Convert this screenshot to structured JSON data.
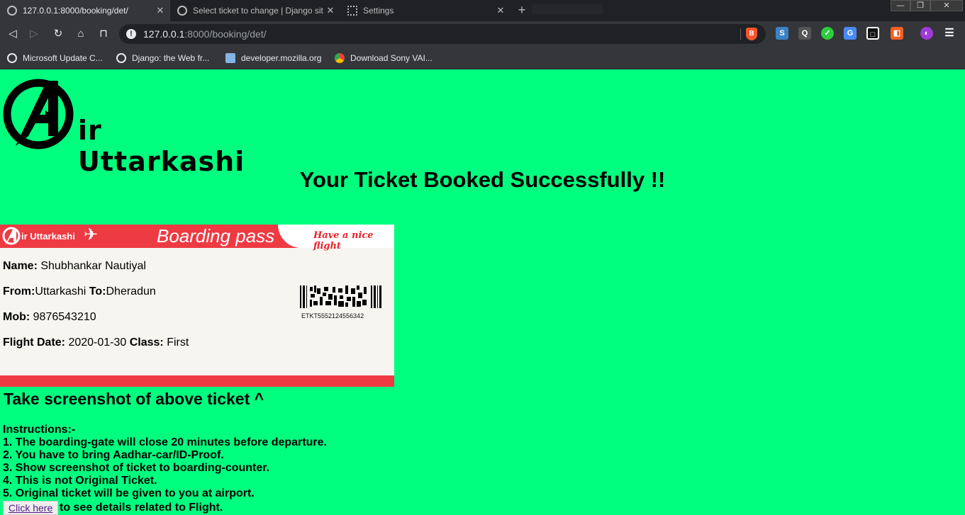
{
  "browser": {
    "tabs": [
      {
        "title": "127.0.0.1:8000/booking/det/",
        "active": true
      },
      {
        "title": "Select ticket to change | Django sit",
        "active": false
      },
      {
        "title": "Settings",
        "active": false
      }
    ],
    "new_tab": "+",
    "window_controls": {
      "minimize": "—",
      "restore": "❐",
      "close": "✕"
    },
    "url_host": "127.0.0.1",
    "url_path": ":8000/booking/det/",
    "bookmarks": [
      {
        "label": "Microsoft Update C..."
      },
      {
        "label": "Django: the Web fr..."
      },
      {
        "label": "developer.mozilla.org"
      },
      {
        "label": "Download Sony VAI..."
      }
    ],
    "extensions": [
      "S",
      "Q",
      "✓",
      "G",
      "□",
      "◧",
      "◐",
      "☰"
    ]
  },
  "page": {
    "logo_text": "ir Uttarkashi",
    "headline": "Your Ticket Booked Successfully !!",
    "ticket": {
      "airline_label": "ir Uttarkashi",
      "boarding_pass_label": "Boarding pass",
      "tagline": "Have a nice flight",
      "name_label": "Name:",
      "name_value": " Shubhankar Nautiyal",
      "from_label": "From:",
      "from_value": "Uttarkashi ",
      "to_label": "To:",
      "to_value": "Dheradun",
      "mob_label": "Mob:",
      "mob_value": " 9876543210",
      "date_label": "Flight Date:",
      "date_value": " 2020-01-30 ",
      "class_label": "Class:",
      "class_value": " First",
      "ticket_code": "ETKT5552124556342"
    },
    "screenshot_note": "Take screenshot of above ticket ^",
    "instructions_title": "Instructions:-",
    "instructions": [
      "1. The boarding-gate will close 20 minutes before departure.",
      "2. You have to bring Aadhar-car/ID-Proof.",
      "3. Show screenshot of ticket to boarding-counter.",
      "4. This is not Original Ticket.",
      "5. Original ticket will be given to you at airport."
    ],
    "click_button": "Click here",
    "click_tail": " to see details related to Flight."
  },
  "colors": {
    "page_bg": "#00ff7f",
    "ticket_red": "#ee3a43",
    "ticket_bg": "#f6f5f0"
  }
}
